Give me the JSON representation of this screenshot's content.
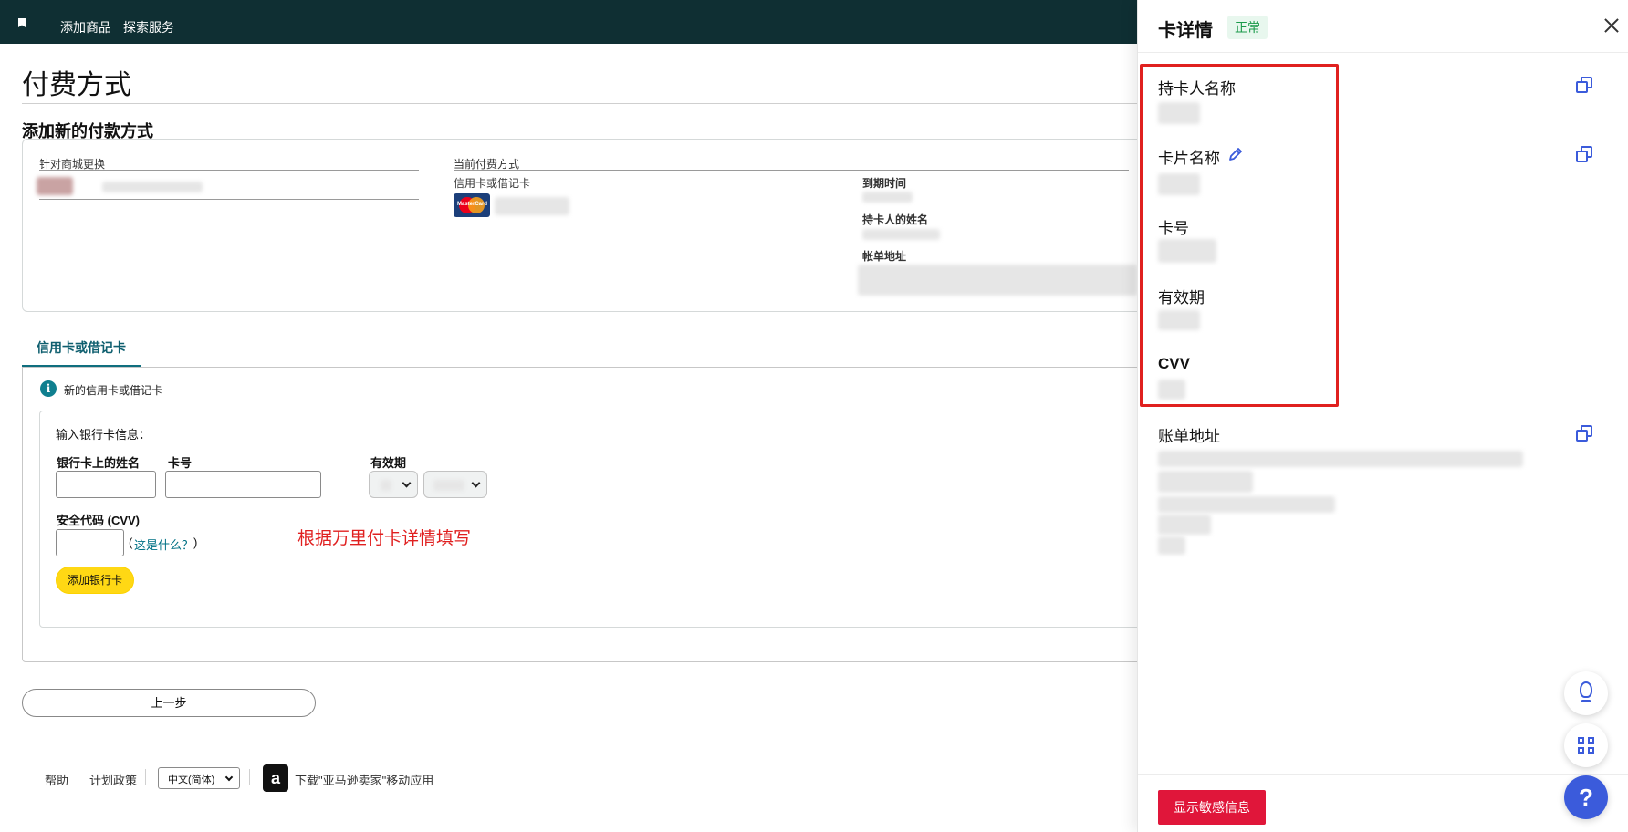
{
  "topbar": {
    "nav": [
      "添加商品",
      "探索服务"
    ]
  },
  "page": {
    "title": "付费方式",
    "section_title": "添加新的付款方式"
  },
  "current_card": {
    "switch_store_label": "针对商城更换",
    "current_method_label": "当前付费方式",
    "card_type_label": "信用卡或借记卡",
    "card_brand": "MasterCard",
    "expiry_label": "到期时间",
    "holder_label": "持卡人的姓名",
    "billing_label": "帐单地址"
  },
  "tab": {
    "label": "信用卡或借记卡"
  },
  "new_card": {
    "info_text": "新的信用卡或借记卡",
    "enter_info": "输入银行卡信息：",
    "name_label": "银行卡上的姓名",
    "number_label": "卡号",
    "expiry_label": "有效期",
    "cvv_label": "安全代码 (CVV)",
    "whats_this_open": "(",
    "whats_this": "这是什么？",
    "whats_this_close": ")",
    "add_button": "添加银行卡",
    "annotation": "根据万里付卡详情填写"
  },
  "back_button": "上一步",
  "footer": {
    "help": "帮助",
    "policy": "计划政策",
    "language": "中文(简体)",
    "app_icon": "a",
    "app_text": "下载\"亚马逊卖家\"移动应用"
  },
  "drawer": {
    "title": "卡详情",
    "status": "正常",
    "fields": {
      "holder_name": "持卡人名称",
      "card_name": "卡片名称",
      "card_number": "卡号",
      "expiry": "有效期",
      "cvv": "CVV",
      "billing_address": "账单地址"
    },
    "show_sensitive_button": "显示敏感信息",
    "help_button": "?"
  },
  "colors": {
    "topbar": "#0f2f33",
    "accent_teal": "#007185",
    "add_button": "#ffd814",
    "annotation_red": "#e02020",
    "status_green": "#1a9a4a",
    "primary_red": "#e0163a",
    "icon_blue": "#3b5bdb"
  },
  "icons": [
    "bookmark-icon",
    "mastercard-logo",
    "info-icon",
    "chevron-down-icon",
    "amazon-app-icon",
    "close-icon",
    "copy-icon",
    "edit-icon",
    "lightbulb-icon",
    "qr-code-icon",
    "help-icon"
  ]
}
